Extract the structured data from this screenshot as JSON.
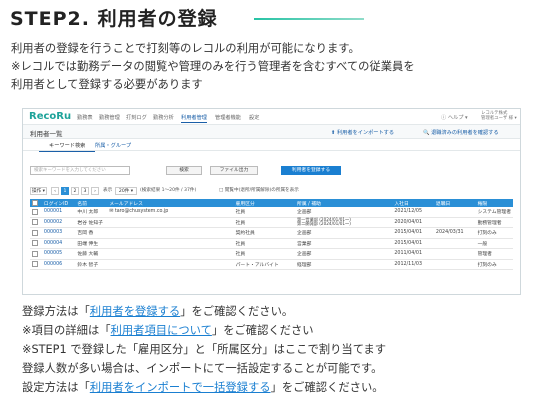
{
  "heading": "STEP2. 利用者の登録",
  "intro": [
    "利用者の登録を行うことで打刻等のレコルの利用が可能になります。",
    "※レコルでは勤務データの閲覧や管理のみを行う管理者を含むすべての従業員を",
    "利用者として登録する必要があります"
  ],
  "app": {
    "logo": "RecoRu",
    "nav": [
      "勤務表",
      "勤務管理",
      "打刻ログ",
      "勤務分析",
      "利用者管理",
      "管理者機能",
      "設定"
    ],
    "active_nav": "利用者管理",
    "help": "ⓘ ヘルプ ▾",
    "company_line1": "レコルテ株式",
    "company_line2": "管理者ユーザ 様 ▾",
    "page_title": "利用者一覧",
    "import_link": "⬆ 利用者をインポートする",
    "exported_link": "🔍 退職済みの利用者を確認する",
    "tabs": [
      "キーワード検索",
      "所属・グループ"
    ],
    "search_placeholder": "検索キーワードを入力してください",
    "search_button": "検索",
    "file_button": "ファイル出力",
    "register_button": "利用者を登録する",
    "pager": {
      "action": "操作 ▾",
      "pages": [
        "‹",
        "1",
        "2",
        "3",
        "›"
      ],
      "display_label": "表示",
      "display_value": "20件 ▾",
      "range_text": "(検索結果 1〜20件 / 37件)",
      "filter_text": "□ 閲覧中(退所/所属解除)の所属を表示"
    },
    "columns": [
      "",
      "ログインID",
      "名前",
      "メールアドレス",
      "雇用区分",
      "所属 / 補助",
      "入社日",
      "退職日",
      "権限"
    ],
    "rows": [
      {
        "id": "000001",
        "name": "中川 太郎",
        "email": "taro@chusystem.co.jp",
        "emp": "社員",
        "dept": "企画部",
        "dept2": "",
        "join": "2021/12/05",
        "leave": "",
        "role": "システム管理者"
      },
      {
        "id": "000002",
        "name": "岩谷 佐知子",
        "email": "",
        "emp": "社員",
        "dept": "第一営業部 (2024/01/01〜)",
        "dept2": "第二開発部 (2024/01/01〜)",
        "join": "2020/04/01",
        "leave": "",
        "role": "勤務管理者"
      },
      {
        "id": "000003",
        "name": "吉岡 香",
        "email": "",
        "emp": "契約社員",
        "dept": "企画部",
        "dept2": "",
        "join": "2015/04/01",
        "leave": "2024/03/31",
        "role": "打刻のみ"
      },
      {
        "id": "000004",
        "name": "田端 伸生",
        "email": "",
        "emp": "社員",
        "dept": "営業部",
        "dept2": "",
        "join": "2015/04/01",
        "leave": "",
        "role": "一般"
      },
      {
        "id": "000005",
        "name": "佐藤 大輔",
        "email": "",
        "emp": "社員",
        "dept": "企画部",
        "dept2": "",
        "join": "2011/04/01",
        "leave": "",
        "role": "管理者"
      },
      {
        "id": "000006",
        "name": "鈴木 智子",
        "email": "",
        "emp": "パート・アルバイト",
        "dept": "経理部",
        "dept2": "",
        "join": "2012/11/03",
        "leave": "",
        "role": "打刻のみ"
      }
    ]
  },
  "body": {
    "line1_pre": "登録方法は「",
    "line1_link": "利用者を登録する",
    "line1_post": "」をご確認ください。",
    "line2_pre": "※項目の詳細は「",
    "line2_link": "利用者項目について",
    "line2_post": "」をご確認ください",
    "line3": "※STEP1 で登録した「雇用区分」と「所属区分」はここで割り当てます",
    "line4": "登録人数が多い場合は、インポートにて一括設定することが可能です。",
    "line5_pre": "設定方法は「",
    "line5_link": "利用者をインポートで一括登録する",
    "line5_post": "」をご確認ください。"
  },
  "colors": {
    "accent": "#27c3a5",
    "link": "#1a7fd1",
    "table_header": "#2a8fd6"
  }
}
